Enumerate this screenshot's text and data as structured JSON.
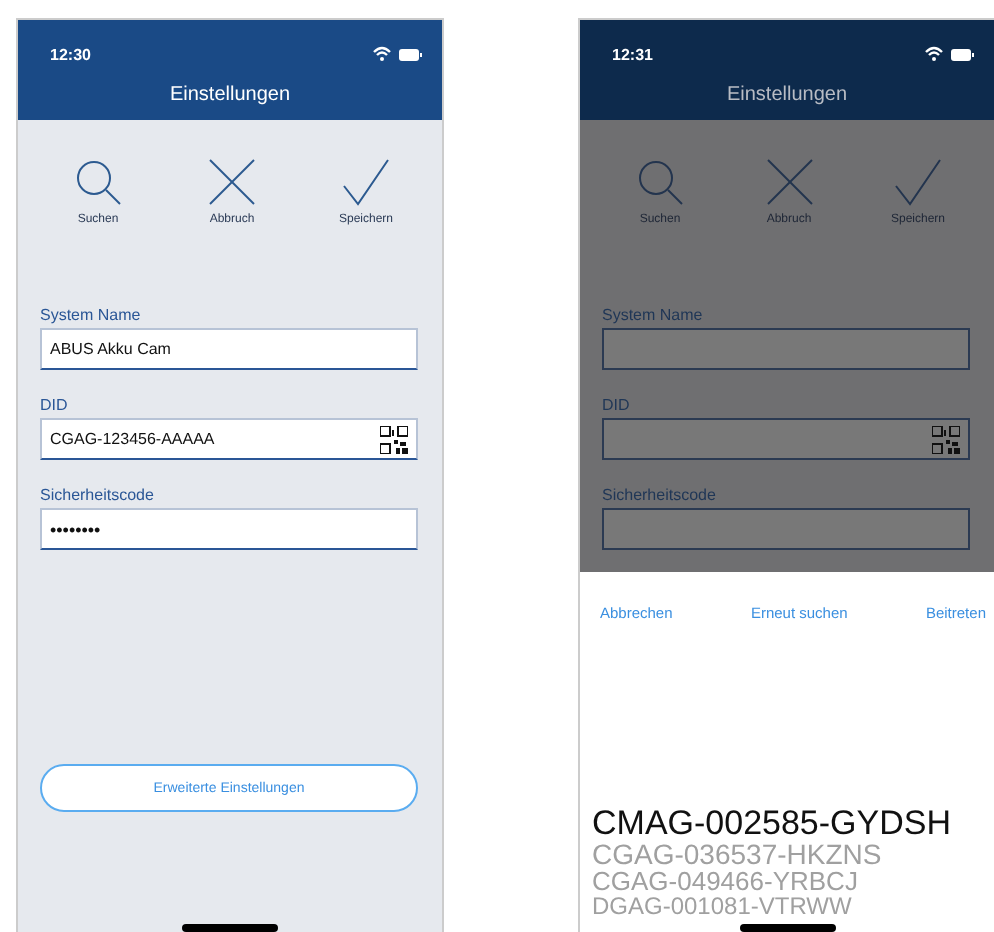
{
  "screens": [
    {
      "status_bar": {
        "time": "12:30"
      },
      "title": "Einstellungen",
      "dimmed": false,
      "toolbar": [
        {
          "kind": "search",
          "label": "Suchen"
        },
        {
          "kind": "cancel",
          "label": "Abbruch"
        },
        {
          "kind": "save",
          "label": "Speichern"
        }
      ],
      "fields": [
        {
          "kind": "text",
          "label": "System Name",
          "value": "ABUS Akku Cam"
        },
        {
          "kind": "qr",
          "label": "DID",
          "value": "CGAG-123456-AAAAA"
        },
        {
          "kind": "password",
          "label": "Sicherheitscode",
          "value": "••••••••"
        }
      ],
      "advanced_button": "Erweiterte Einstellungen"
    },
    {
      "status_bar": {
        "time": "12:31"
      },
      "title": "Einstellungen",
      "dimmed": true,
      "toolbar": [
        {
          "kind": "search",
          "label": "Suchen"
        },
        {
          "kind": "cancel",
          "label": "Abbruch"
        },
        {
          "kind": "save",
          "label": "Speichern"
        }
      ],
      "fields": [
        {
          "kind": "text",
          "label": "System Name"
        },
        {
          "kind": "qr",
          "label": "DID"
        },
        {
          "kind": "password",
          "label": "Sicherheitscode"
        }
      ],
      "sheet": {
        "actions": [
          "Abbrechen",
          "Erneut suchen",
          "Beitreten"
        ],
        "picker": [
          {
            "label": "CMAG-002585-GYDSH",
            "selected": true
          },
          {
            "label": "CGAG-036537-HKZNS",
            "selected": false
          },
          {
            "label": "CGAG-049466-YRBCJ",
            "selected": false
          },
          {
            "label": "DGAG-001081-VTRWW",
            "selected": false
          }
        ]
      }
    }
  ]
}
